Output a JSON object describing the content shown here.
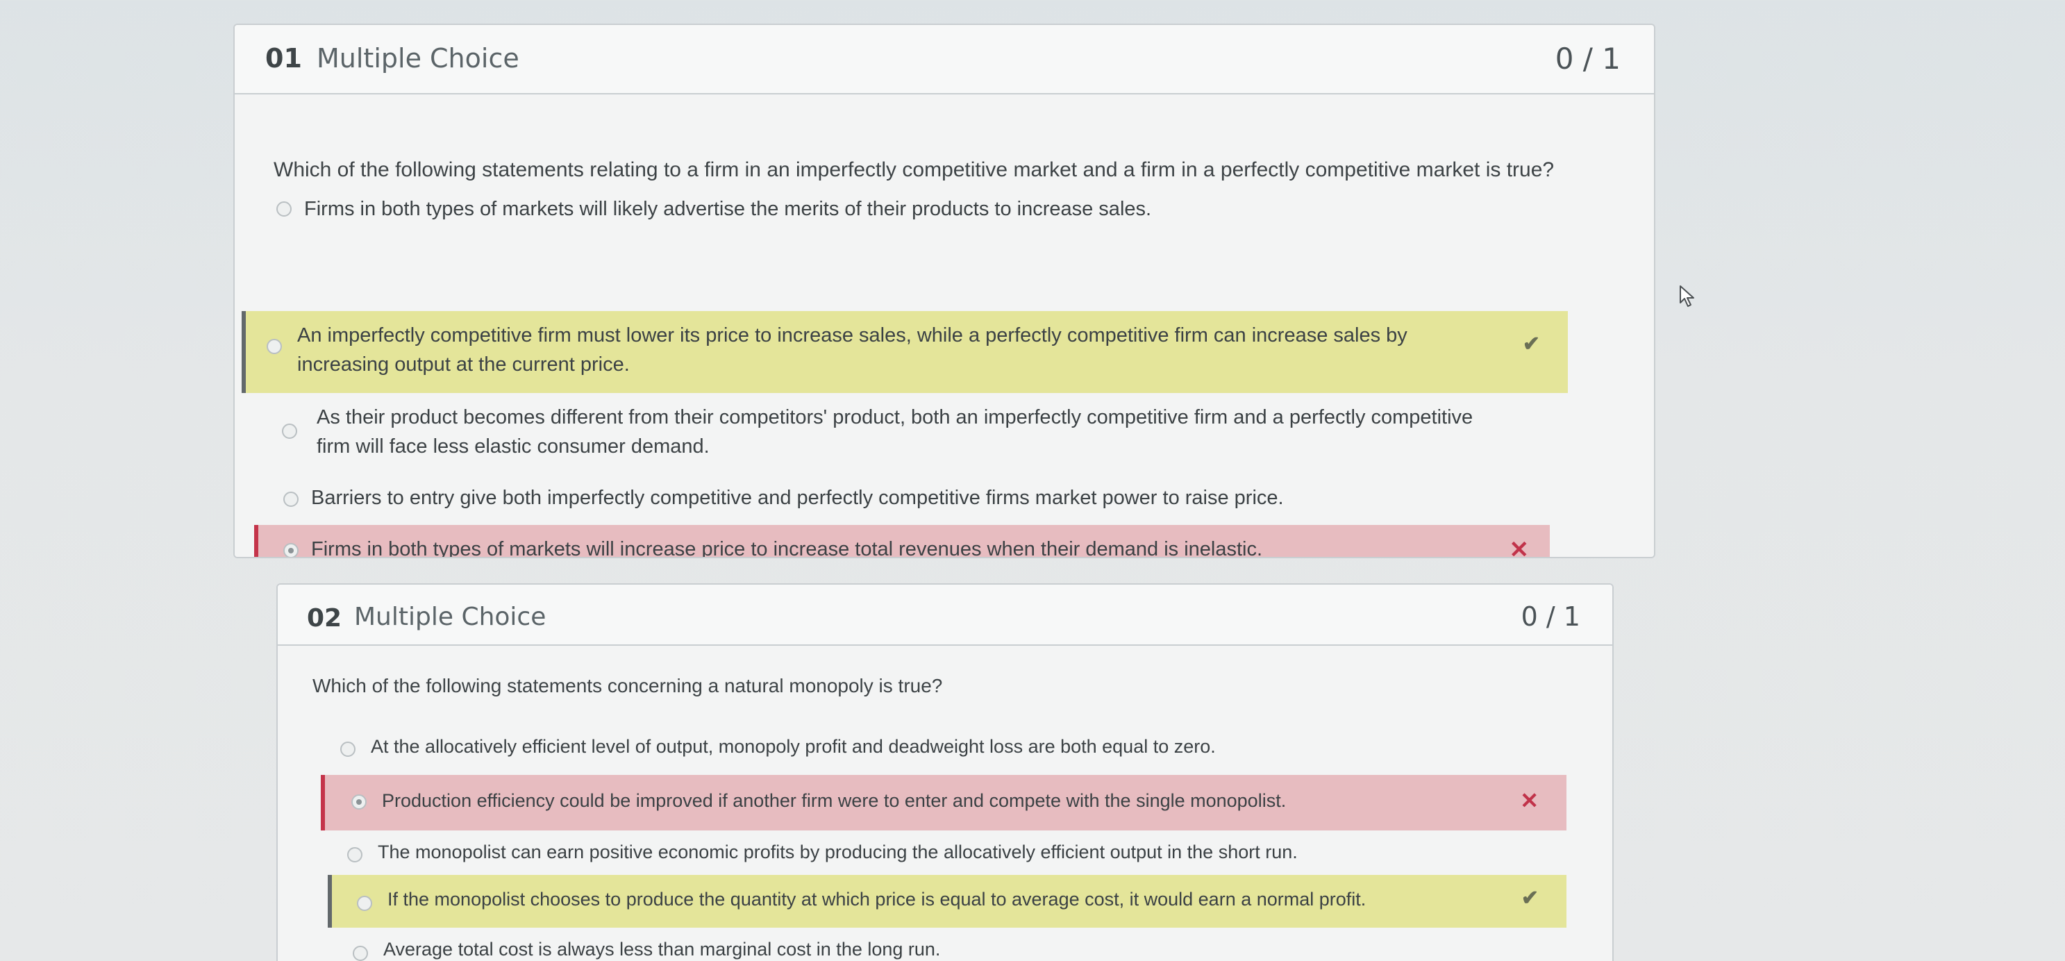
{
  "questions": [
    {
      "number": "01",
      "type": "Multiple Choice",
      "score": "0 / 1",
      "prompt": "Which of the following statements relating to a firm in an imperfectly competitive market and a firm in a perfectly competitive market is true?",
      "options": [
        {
          "text": "Firms in both types of markets will likely advertise the merits of their products to increase sales.",
          "state": "none",
          "selected": false
        },
        {
          "text": "An imperfectly competitive firm must lower its price to increase sales, while a perfectly competitive firm can increase sales by increasing output at the current price.",
          "state": "correct",
          "selected": false,
          "mark": "✔"
        },
        {
          "text": "As their product becomes different from their competitors' product, both an imperfectly competitive firm and a perfectly competitive firm will face less elastic consumer demand.",
          "state": "none",
          "selected": false
        },
        {
          "text": "Barriers to entry give both imperfectly competitive and perfectly competitive firms market power to raise price.",
          "state": "none",
          "selected": false
        },
        {
          "text": "Firms in both types of markets will increase price to increase total revenues when their demand is inelastic.",
          "state": "wrong",
          "selected": true,
          "mark": "✕"
        }
      ]
    },
    {
      "number": "02",
      "type": "Multiple Choice",
      "score": "0 / 1",
      "prompt": "Which of the following statements concerning a natural monopoly is true?",
      "options": [
        {
          "text": "At the allocatively efficient level of output, monopoly profit and deadweight loss are both equal to zero.",
          "state": "none",
          "selected": false
        },
        {
          "text": "Production efficiency could be improved if another firm were to enter and compete with the single monopolist.",
          "state": "wrong",
          "selected": true,
          "mark": "✕"
        },
        {
          "text": "The monopolist can earn positive economic profits by producing the allocatively efficient output in the short run.",
          "state": "none",
          "selected": false
        },
        {
          "text": "If the monopolist chooses to produce the quantity at which price is equal to average cost, it would earn a normal profit.",
          "state": "correct",
          "selected": false,
          "mark": "✔"
        },
        {
          "text": "Average total cost is always less than marginal cost in the long run.",
          "state": "none",
          "selected": false
        }
      ]
    }
  ],
  "colors": {
    "correct_bg": "#e4e59a",
    "wrong_bg": "#e7bcc0",
    "wrong_accent": "#c4344a"
  }
}
